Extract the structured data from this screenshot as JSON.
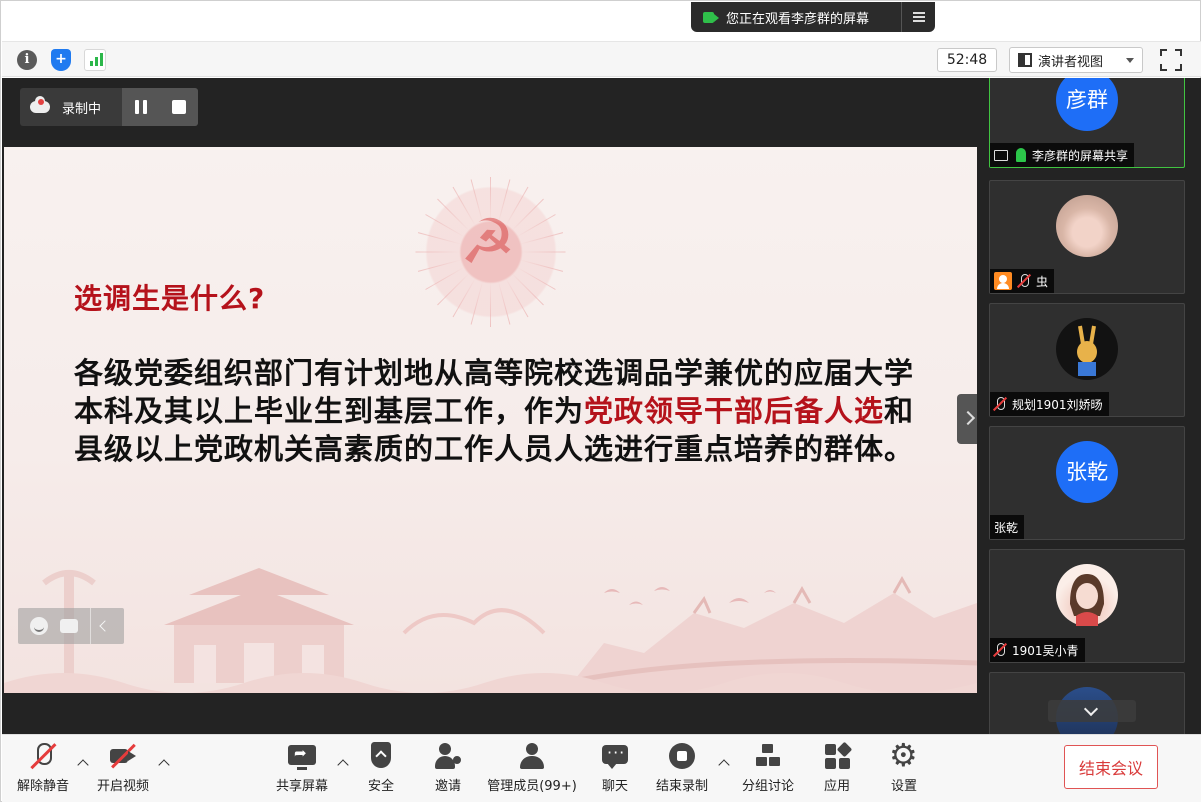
{
  "banner": {
    "text": "您正在观看李彦群的屏幕"
  },
  "info_bar": {
    "timer": "52:48",
    "view_mode": "演讲者视图"
  },
  "recording": {
    "label": "录制中"
  },
  "slide": {
    "title": "选调生是什么?",
    "body_part1": "各级党委组织部门有计划地从高等院校选调品学兼优的应届大学本科及其以上毕业生到基层工作，作为",
    "body_highlight": "党政领导干部后备人选",
    "body_part2": "和县级以上党政机关高素质的工作人员人选进行重点培养的群体。"
  },
  "participants": [
    {
      "avatar_text": "彦群",
      "name": "李彦群的屏幕共享",
      "status": "sharing-mic-on"
    },
    {
      "avatar_text": "",
      "name": "虫",
      "status": "host-muted"
    },
    {
      "avatar_text": "",
      "name": "规划1901刘娇旸",
      "status": "muted"
    },
    {
      "avatar_text": "张乾",
      "name": "张乾",
      "status": "no-audio"
    },
    {
      "avatar_text": "",
      "name": "1901吴小青",
      "status": "muted"
    },
    {
      "avatar_text": "",
      "name": "",
      "status": "partial"
    }
  ],
  "toolbar": {
    "mute": "解除静音",
    "video": "开启视频",
    "share": "共享屏幕",
    "security": "安全",
    "invite": "邀请",
    "members": "管理成员(99+)",
    "chat": "聊天",
    "stop_record": "结束录制",
    "breakout": "分组讨论",
    "apps": "应用",
    "settings": "设置",
    "end": "结束会议"
  },
  "colors": {
    "accent_red": "#b5121b",
    "mic_green": "#2cc64a",
    "avatar_blue": "#1e6ef7"
  }
}
